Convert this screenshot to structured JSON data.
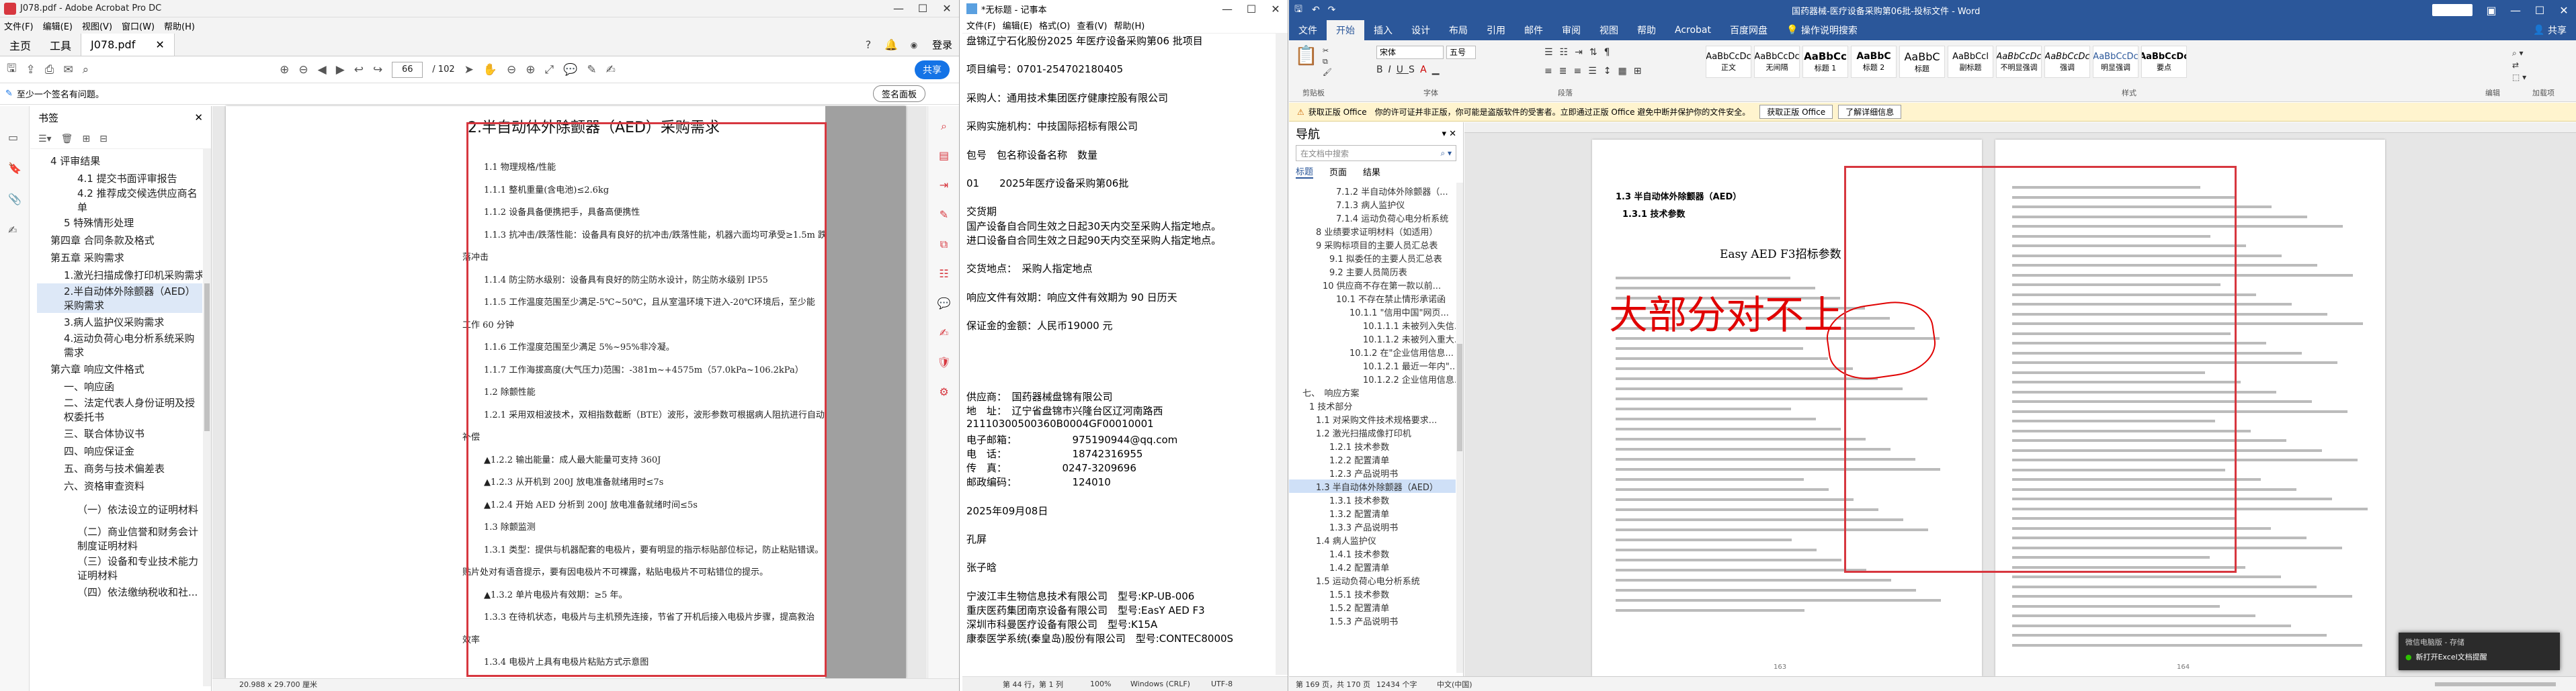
{
  "acrobat": {
    "title": "J078.pdf - Adobe Acrobat Pro DC",
    "menu": [
      "文件(F)",
      "编辑(E)",
      "视图(V)",
      "窗口(W)",
      "帮助(H)"
    ],
    "tabs": [
      "主页",
      "工具",
      "J078.pdf"
    ],
    "login": "登录",
    "page_current": "66",
    "page_total": "/ 102",
    "share": "共享",
    "sign_notice": "至少一个签名有问题。",
    "sign_panel": "签名面板",
    "bookmarks_title": "书签",
    "bookmarks": [
      "4 评审结果",
      "4.1 提交书面评审报告",
      "4.2 推荐成交候选供应商名单",
      "5 特殊情形处理",
      "第四章 合同条款及格式",
      "第五章 采购需求",
      "1.激光扫描成像打印机采购需求",
      "2.半自动体外除颤器（AED）采购需求",
      "3.病人监护仪采购需求",
      "4.运动负荷心电分析系统采购需求",
      "第六章 响应文件格式",
      "一、响应函",
      "二、法定代表人身份证明及授权委托书",
      "三、联合体协议书",
      "四、响应保证金",
      "五、商务与技术偏差表",
      "六、资格审查资料",
      "（一）依法设立的证明材料",
      "（二）商业信誉和财务会计制度证明材料",
      "（三）设备和专业技术能力证明材料",
      "（四）依法缴纳税收和社..."
    ],
    "page_size": "20.988 x 29.700 厘米",
    "pdf_title": "2.半自动体外除颤器（AED）采购需求",
    "pdf_lines": [
      "1.1 物理规格/性能",
      "1.1.1 整机重量(含电池)≤2.6kg",
      "1.1.2 设备具备便携把手，具备高便携性",
      "1.1.3 抗冲击/跌落性能：设备具有良好的抗冲击/跌落性能，机器六面均可承受≥1.5m 跌",
      "落冲击",
      "1.1.4 防尘防水级别：设备具有良好的防尘防水设计，防尘防水级别 IP55",
      "1.1.5 工作温度范围至少满足-5℃~50℃，且从室温环境下进入-20℃环境后，至少能",
      "工作 60 分钟",
      "1.1.6 工作湿度范围至少满足 5%~95%非冷凝。",
      "1.1.7 工作海拔高度(大气压力)范围：-381m~+4575m（57.0kPa~106.2kPa）",
      "1.2 除颤性能",
      "1.2.1 采用双相波技术，双相指数截断（BTE）波形，波形参数可根据病人阻抗进行自动",
      "补偿",
      "▲1.2.2 输出能量：成人最大能量可支持 360J",
      "▲1.2.3 从开机到 200J 放电准备就绪用时≤7s",
      "▲1.2.4 开始 AED 分析到 200J 放电准备就绪时间≤5s",
      "1.3 除颤监测",
      "1.3.1 类型：提供与机器配套的电极片，要有明显的指示标贴部位标记，防止粘贴错误。",
      "贴片处对有语音提示，要有因电极片不可裸露，粘贴电极片不可粘错位的提示。",
      "▲1.3.2 单片电极片有效期：≥5 年。",
      "1.3.3 在待机状态，电极片与主机预先连接，节省了开机后接入电极片步骤，提高救治",
      "效率",
      "1.3.4 电极片上具有电极片粘贴方式示意图"
    ]
  },
  "notepad": {
    "title": "*无标题 - 记事本",
    "menu": [
      "文件(F)",
      "编辑(E)",
      "格式(O)",
      "查看(V)",
      "帮助(H)"
    ],
    "lines": [
      "盘锦辽宁石化股份2025 年医疗设备采购第06 批项目",
      "",
      "项目编号：0701-254702180405",
      "",
      "采购人：通用技术集团医疗健康控股有限公司",
      "",
      "采购实施机构：中技国际招标有限公司",
      "",
      "包号　包名称设备名称　数量",
      "",
      "01　　2025年医疗设备采购第06批",
      "",
      "交货期",
      "国产设备自合同生效之日起30天内交至采购人指定地点。",
      "进口设备自合同生效之日起90天内交至采购人指定地点。",
      "",
      "交货地点：　采购人指定地点",
      "",
      "响应文件有效期：响应文件有效期为 90 日历天",
      "",
      "保证金的金额：人民币19000 元",
      "",
      "",
      "",
      "",
      "供应商：　国药器械盘锦有限公司",
      "地　址：　辽宁省盘锦市兴隆台区辽河南路西",
      "21110300500360B0004GF00010001",
      "电子邮箱：　　　　　　975190944@qq.com",
      "电　话：　　　　　　　18742316955",
      "传　真：　　　　　　0247-3209696",
      "邮政编码：　　　　　　124010",
      "",
      "2025年09月08日",
      "",
      "孔屏",
      "",
      "张子晗",
      "",
      "宁波江丰生物信息技术有限公司　型号:KP-UB-006",
      "重庆医药集团南京设备有限公司　型号:EasY AED F3",
      "深圳市科曼医疗设备有限公司　型号:K15A",
      "康泰医学系统(秦皇岛)股份有限公司　型号:CONTEC8000S"
    ],
    "status": [
      "第 44 行，第 1 列",
      "100%",
      "Windows (CRLF)",
      "UTF-8"
    ]
  },
  "word": {
    "title": "国药器械-医疗设备采购第06批-投标文件 - Word",
    "ribbon_tabs": [
      "文件",
      "开始",
      "插入",
      "设计",
      "布局",
      "引用",
      "邮件",
      "审阅",
      "视图",
      "帮助",
      "Acrobat",
      "百度网盘",
      "操作说明搜索"
    ],
    "share": "共享",
    "font": "宋体",
    "size": "五号",
    "styles": [
      "正文",
      "无间隔",
      "标题 1",
      "标题 2",
      "标题",
      "副标题",
      "不明显强调",
      "强调",
      "明显强调",
      "要点"
    ],
    "group_labels": [
      "剪贴板",
      "字体",
      "段落",
      "样式",
      "编辑",
      "加载项"
    ],
    "activation_msg": "获取正版 Office　你的许可证并非正版，你可能是盗版软件的受害者。立即通过正版 Office 避免中断并保护你的文件安全。",
    "activation_btn1": "获取正版 Office",
    "activation_btn2": "了解详细信息",
    "nav_title": "导航",
    "nav_search": "在文档中搜索",
    "nav_tabs": [
      "标题",
      "页面",
      "结果"
    ],
    "nav_items": [
      "7.1.2 半自动体外除颤器（...",
      "7.1.3 病人监护仪",
      "7.1.4 运动负荷心电分析系统",
      "8 业绩要求证明材料（如适用）",
      "9 采购标项目的主要人员汇总表",
      "9.1 拟委任的主要人员汇总表",
      "9.2 主要人员简历表",
      "10 供应商不存在第一款以前...",
      "10.1 不存在禁止情形承诺函",
      "10.1.1 \"信用中国\"网页...",
      "10.1.1.1 未被列入失信...",
      "10.1.1.2 未被列入重大...",
      "10.1.2 在\"企业信用信息...",
      "10.1.2.1 最近一年内\"...",
      "10.1.2.2 企业信用信息...",
      "七、　响应方案",
      "1 技术部分",
      "1.1 对采购文件技术规格要求...",
      "1.2 激光扫描成像打印机",
      "1.2.1 技术参数",
      "1.2.2 配置清单",
      "1.2.3 产品说明书",
      "1.3 半自动体外除颤器（AED）",
      "1.3.1 技术参数",
      "1.3.2 配置清单",
      "1.3.3 产品说明书",
      "1.4 病人监护仪",
      "1.4.1 技术参数",
      "1.4.2 配置清单",
      "1.5 运动负荷心电分析系统",
      "1.5.1 技术参数",
      "1.5.2 配置清单",
      "1.5.3 产品说明书"
    ],
    "doc_heading1": "1.3 半自动体外除颤器（AED）",
    "doc_heading2": "1.3.1 技术参数",
    "doc_table_title": "Easy AED F3招标参数",
    "annotation": "大部分对不上",
    "page_no_left": "163",
    "page_no_right": "164",
    "status": [
      "第 169 页，共 170 页",
      "12434 个字",
      "中文(中国)"
    ],
    "notify_title": "微信电脑版 - 存储",
    "notify_text": "新打开Excel文档提醒"
  },
  "colors": {
    "word_blue": "#2b579a",
    "acro_red": "#d7373f",
    "annot_red": "#e00000",
    "acro_blue": "#1473e6"
  }
}
